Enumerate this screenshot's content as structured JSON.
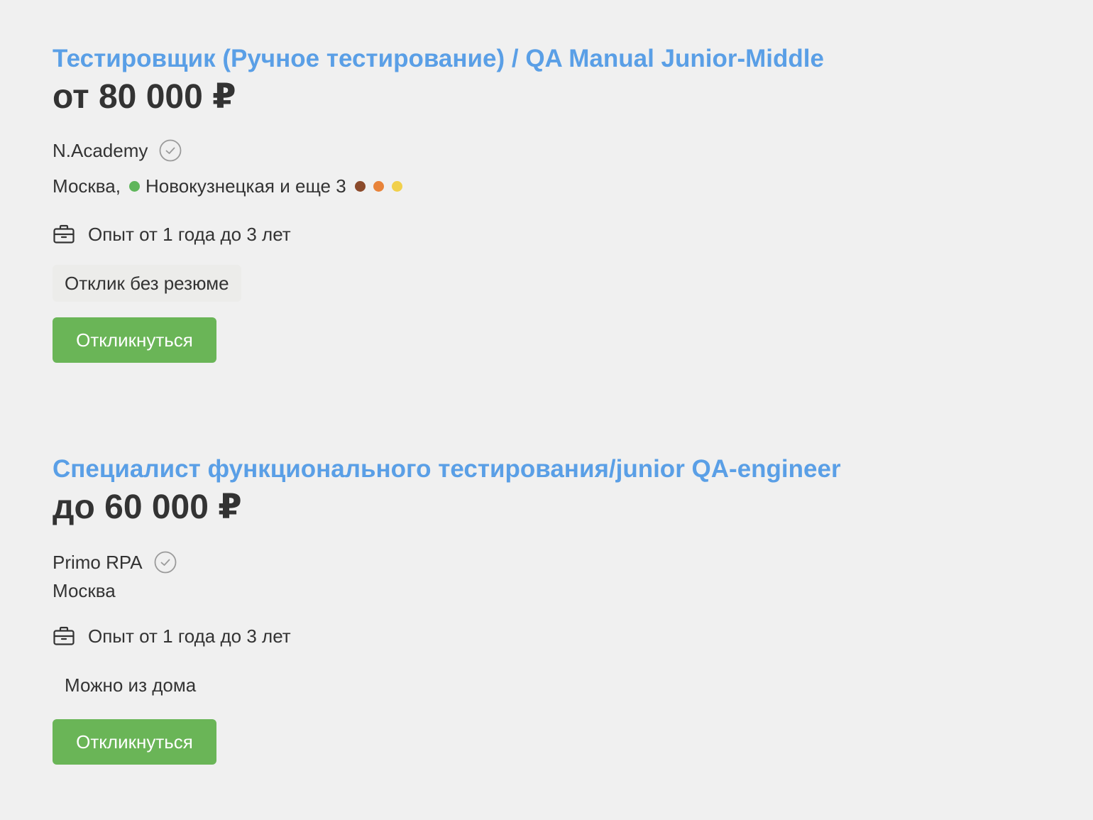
{
  "vacancies": [
    {
      "title": "Тестировщик (Ручное тестирование) / QA Manual Junior-Middle",
      "salary": "от 80 000 ₽",
      "company": "N.Academy",
      "city": "Москва,",
      "metro": "Новокузнецкая",
      "metro_color": "#5fb65b",
      "metro_more": "и еще 3",
      "metro_more_colors": [
        "#8b4a2b",
        "#e8833a",
        "#f1d04b"
      ],
      "experience": "Опыт от 1 года до 3 лет",
      "tag": "Отклик без резюме",
      "apply_label": "Откликнуться"
    },
    {
      "title": "Специалист функционального тестирования/junior QA-engineer",
      "salary": "до 60 000 ₽",
      "company": "Primo RPA",
      "city": "Москва",
      "experience": "Опыт от 1 года до 3 лет",
      "tag": "Можно из дома",
      "apply_label": "Откликнуться"
    }
  ],
  "icons": {
    "verified": "check-circle-icon",
    "experience": "briefcase-icon"
  },
  "colors": {
    "background": "#f0f0f0",
    "title_link": "#5a9fe6",
    "text": "#333333",
    "button": "#6ab557",
    "tag_background": "#ececea"
  }
}
